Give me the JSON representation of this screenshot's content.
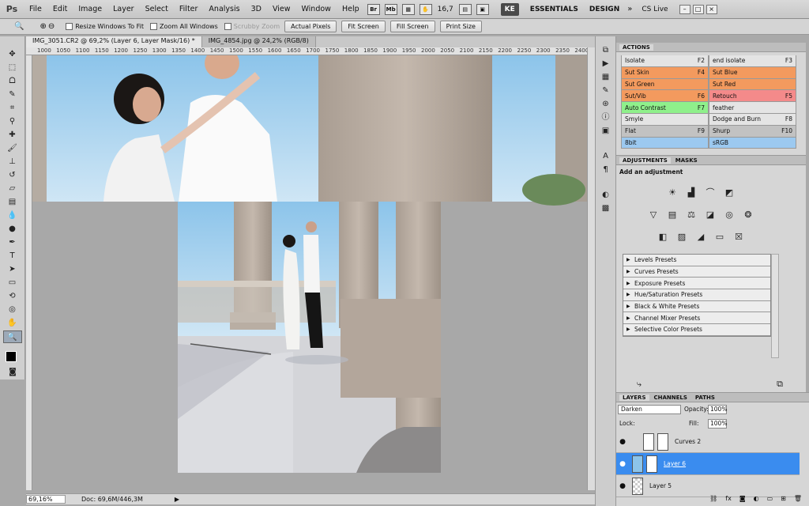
{
  "app": {
    "logo": "Ps"
  },
  "menubar": {
    "items": [
      "File",
      "Edit",
      "Image",
      "Layer",
      "Select",
      "Filter",
      "Analysis",
      "3D",
      "View",
      "Window",
      "Help"
    ],
    "zoom": "16,7",
    "user": "KE",
    "workspaces": [
      "ESSENTIALS",
      "DESIGN"
    ],
    "cs_live": "CS Live"
  },
  "options": {
    "resize_windows": "Resize Windows To Fit",
    "zoom_all": "Zoom All Windows",
    "scrubby": "Scrubby Zoom",
    "buttons": [
      "Actual Pixels",
      "Fit Screen",
      "Fill Screen",
      "Print Size"
    ]
  },
  "doc_tabs": [
    "IMG_3051.CR2 @ 69,2% (Layer 6, Layer Mask/16) *",
    "IMG_4854.jpg @ 24,2% (RGB/8)"
  ],
  "ruler_ticks": [
    "1000",
    "1050",
    "1100",
    "1150",
    "1200",
    "1250",
    "1300",
    "1350",
    "1400",
    "1450",
    "1500",
    "1550",
    "1600",
    "1650",
    "1700",
    "1750",
    "1800",
    "1850",
    "1900",
    "1950",
    "2000",
    "2050",
    "2100",
    "2150",
    "2200",
    "2250",
    "2300",
    "2350",
    "2400"
  ],
  "status": {
    "zoom": "69,16%",
    "doc": "Doc: 69,6M/446,3M"
  },
  "actions": {
    "title": "ACTIONS",
    "items": [
      {
        "label": "Isolate",
        "key": "F2",
        "color": "#e4e4e4"
      },
      {
        "label": "end isolate",
        "key": "F3",
        "color": "#e4e4e4"
      },
      {
        "label": "Sut Skin",
        "key": "F4",
        "color": "#f39a5e"
      },
      {
        "label": "Sut Blue",
        "key": "",
        "color": "#f39a5e"
      },
      {
        "label": "Sut Green",
        "key": "",
        "color": "#f39a5e"
      },
      {
        "label": "Sut Red",
        "key": "",
        "color": "#f39a5e"
      },
      {
        "label": "Sut/Vib",
        "key": "F6",
        "color": "#f39a5e"
      },
      {
        "label": "Retouch",
        "key": "F5",
        "color": "#f48a8a"
      },
      {
        "label": "Auto Contrast",
        "key": "F7",
        "color": "#8ff08b"
      },
      {
        "label": "feather",
        "key": "",
        "color": "#e4e4e4"
      },
      {
        "label": "Smyle",
        "key": "",
        "color": "#e4e4e4"
      },
      {
        "label": "Dodge and Burn",
        "key": "F8",
        "color": "#e4e4e4"
      },
      {
        "label": "Flat",
        "key": "F9",
        "color": "#c2c2c2"
      },
      {
        "label": "Shurp",
        "key": "F10",
        "color": "#c2c2c2"
      },
      {
        "label": "8bit",
        "key": "",
        "color": "#9cc9f0"
      },
      {
        "label": "sRGB",
        "key": "",
        "color": "#9cc9f0"
      }
    ]
  },
  "adjustments": {
    "tabs": [
      "ADJUSTMENTS",
      "MASKS"
    ],
    "heading": "Add an adjustment",
    "presets": [
      "Levels Presets",
      "Curves Presets",
      "Exposure Presets",
      "Hue/Saturation Presets",
      "Black & White Presets",
      "Channel Mixer Presets",
      "Selective Color Presets"
    ]
  },
  "layers": {
    "tabs": [
      "LAYERS",
      "CHANNELS",
      "PATHS"
    ],
    "blend_mode": "Darken",
    "opacity_label": "Opacity:",
    "opacity": "100%",
    "lock_label": "Lock:",
    "fill_label": "Fill:",
    "fill": "100%",
    "list": [
      {
        "name": "Curves 2",
        "selected": false
      },
      {
        "name": "Layer 6",
        "selected": true
      },
      {
        "name": "Layer 5",
        "selected": false
      }
    ]
  }
}
